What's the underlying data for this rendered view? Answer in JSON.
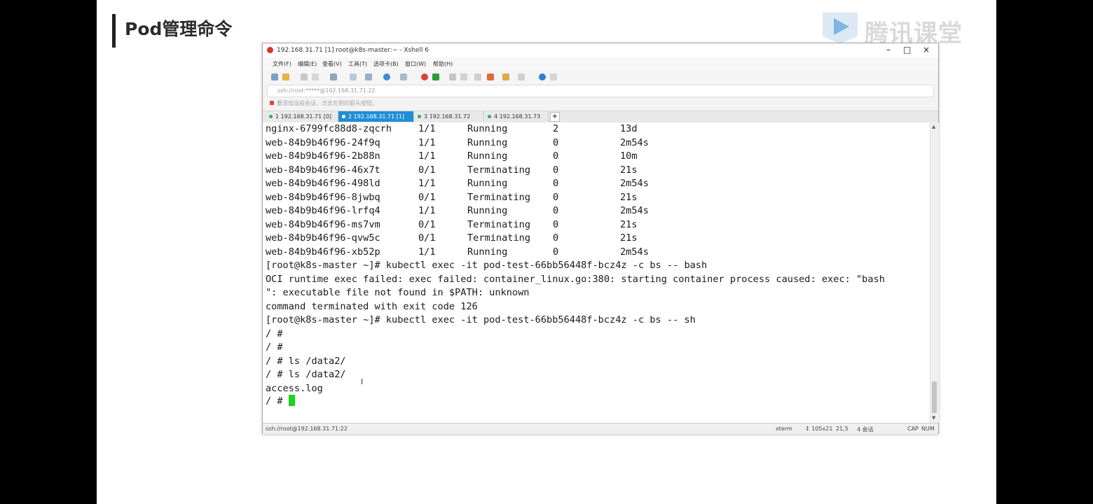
{
  "slide": {
    "title": "Pod管理命令",
    "logo_text": "腾讯课堂"
  },
  "window": {
    "title": "192.168.31.71 [1]    root@k8s-master:~ - Xshell 6",
    "minimize": "–",
    "maximize": "□",
    "close": "×"
  },
  "menu": [
    "文件(F)",
    "编辑(E)",
    "查看(V)",
    "工具(T)",
    "选项卡(B)",
    "窗口(W)",
    "帮助(H)"
  ],
  "address": "ssh://root:*****@192.168.31.71:22",
  "hint": "要添加当前会话，点击左侧的箭头按钮。",
  "tabs": [
    {
      "label": "1 192.168.31.71 [0]"
    },
    {
      "label": "2 192.168.31.71 [1]"
    },
    {
      "label": "3 192.168.31.72"
    },
    {
      "label": "4 192.168.31.73"
    }
  ],
  "tab_add": "+",
  "terminal": {
    "pods": [
      {
        "name": "nginx-6799fc88d8-zqcrh",
        "ready": "1/1",
        "status": "Running",
        "restarts": "2",
        "age": "13d"
      },
      {
        "name": "web-84b9b46f96-24f9q",
        "ready": "1/1",
        "status": "Running",
        "restarts": "0",
        "age": "2m54s"
      },
      {
        "name": "web-84b9b46f96-2b88n",
        "ready": "1/1",
        "status": "Running",
        "restarts": "0",
        "age": "10m"
      },
      {
        "name": "web-84b9b46f96-46x7t",
        "ready": "0/1",
        "status": "Terminating",
        "restarts": "0",
        "age": "21s"
      },
      {
        "name": "web-84b9b46f96-498ld",
        "ready": "1/1",
        "status": "Running",
        "restarts": "0",
        "age": "2m54s"
      },
      {
        "name": "web-84b9b46f96-8jwbq",
        "ready": "0/1",
        "status": "Terminating",
        "restarts": "0",
        "age": "21s"
      },
      {
        "name": "web-84b9b46f96-lrfq4",
        "ready": "1/1",
        "status": "Running",
        "restarts": "0",
        "age": "2m54s"
      },
      {
        "name": "web-84b9b46f96-ms7vm",
        "ready": "0/1",
        "status": "Terminating",
        "restarts": "0",
        "age": "21s"
      },
      {
        "name": "web-84b9b46f96-qvw5c",
        "ready": "0/1",
        "status": "Terminating",
        "restarts": "0",
        "age": "21s"
      },
      {
        "name": "web-84b9b46f96-xb52p",
        "ready": "1/1",
        "status": "Running",
        "restarts": "0",
        "age": "2m54s"
      }
    ],
    "lines": [
      "[root@k8s-master ~]# kubectl exec -it pod-test-66bb56448f-bcz4z -c bs -- bash",
      "OCI runtime exec failed: exec failed: container_linux.go:380: starting container process caused: exec: \"bash",
      "\": executable file not found in $PATH: unknown",
      "command terminated with exit code 126",
      "[root@k8s-master ~]# kubectl exec -it pod-test-66bb56448f-bcz4z -c bs -- sh",
      "/ #",
      "/ #",
      "/ # ls /data2/",
      "/ # ls /data2/",
      "access.log"
    ],
    "prompt": "/ # ",
    "ibeam": "I"
  },
  "status": {
    "session": "ssh://root@192.168.31.71:22",
    "term": "xterm",
    "size": "↕ 105x21",
    "pos": "21,5",
    "sessions": "4 会话",
    "caps": "CAP",
    "num": "NUM"
  },
  "colors": {
    "active_tab": "#1f8fd6",
    "cursor": "#1fd21f"
  }
}
